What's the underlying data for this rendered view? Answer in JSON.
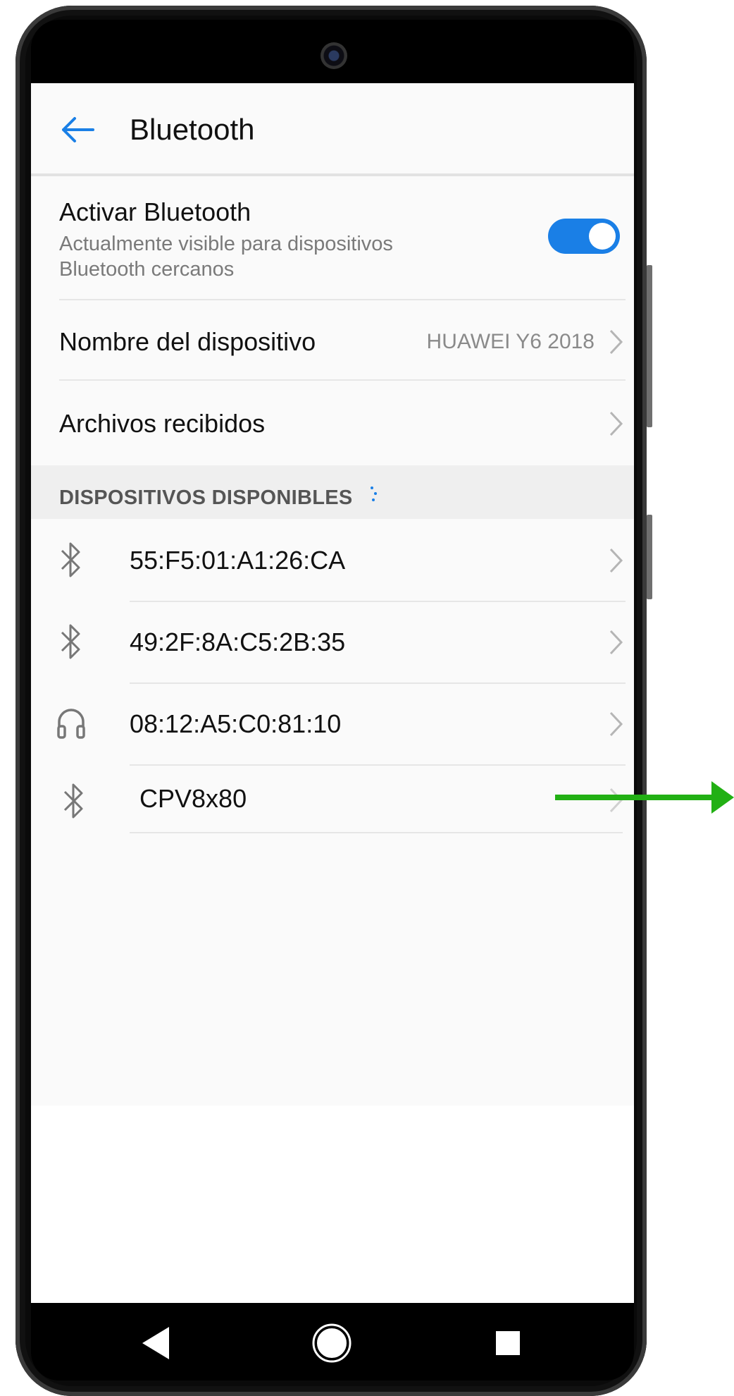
{
  "header": {
    "title": "Bluetooth",
    "back_icon": "back-arrow-icon"
  },
  "bluetooth_toggle": {
    "label": "Activar Bluetooth",
    "description": "Actualmente visible para dispositivos Bluetooth cercanos",
    "enabled": true
  },
  "device_name": {
    "label": "Nombre del dispositivo",
    "value": "HUAWEI Y6 2018"
  },
  "received_files": {
    "label": "Archivos recibidos"
  },
  "available_section": {
    "label": "DISPOSITIVOS DISPONIBLES"
  },
  "devices": [
    {
      "name": "55:F5:01:A1:26:CA",
      "icon": "bluetooth-icon"
    },
    {
      "name": "49:2F:8A:C5:2B:35",
      "icon": "bluetooth-icon"
    },
    {
      "name": "08:12:A5:C0:81:10",
      "icon": "headphones-icon"
    },
    {
      "name": "CPV8x80",
      "icon": "bluetooth-icon"
    }
  ],
  "colors": {
    "accent": "#1a7fe6",
    "annotation_arrow": "#22b014"
  },
  "navbar": {
    "back": "nav-back-icon",
    "home": "nav-home-icon",
    "recents": "nav-recents-icon"
  }
}
